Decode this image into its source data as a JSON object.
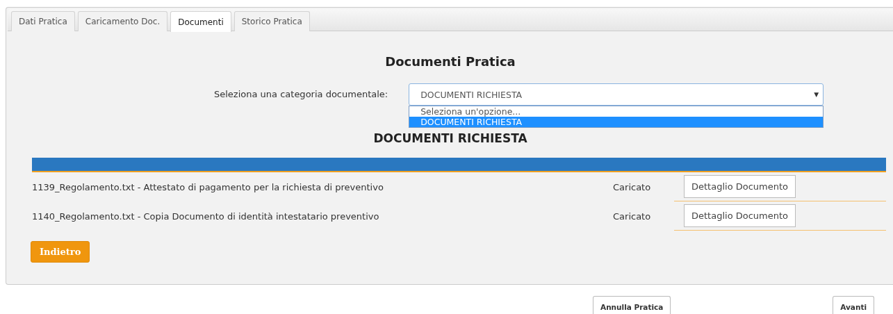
{
  "tabs": [
    {
      "label": "Dati Pratica",
      "selected": false
    },
    {
      "label": "Caricamento Doc.",
      "selected": false
    },
    {
      "label": "Documenti",
      "selected": true
    },
    {
      "label": "Storico Pratica",
      "selected": false
    }
  ],
  "title": "Documenti Pratica",
  "category_select": {
    "label": "Seleziona una categoria documentale:",
    "value": "DOCUMENTI RICHIESTA",
    "toggle_icon": "▼",
    "expanded": true,
    "options": [
      {
        "label": "Seleziona un'opzione...",
        "selected": false
      },
      {
        "label": "DOCUMENTI RICHIESTA",
        "selected": true
      }
    ]
  },
  "section_title": "DOCUMENTI RICHIESTA",
  "documents": [
    {
      "name": "1139_Regolamento.txt - Attestato di pagamento per la richiesta di preventivo",
      "status": "Caricato",
      "action": "Dettaglio Documento"
    },
    {
      "name": "1140_Regolamento.txt - Copia Documento di identità intestatario preventivo",
      "status": "Caricato",
      "action": "Dettaglio Documento"
    }
  ],
  "back_button": "Indietro",
  "footer_buttons": [
    "Annulla Pratica",
    "Avanti"
  ]
}
